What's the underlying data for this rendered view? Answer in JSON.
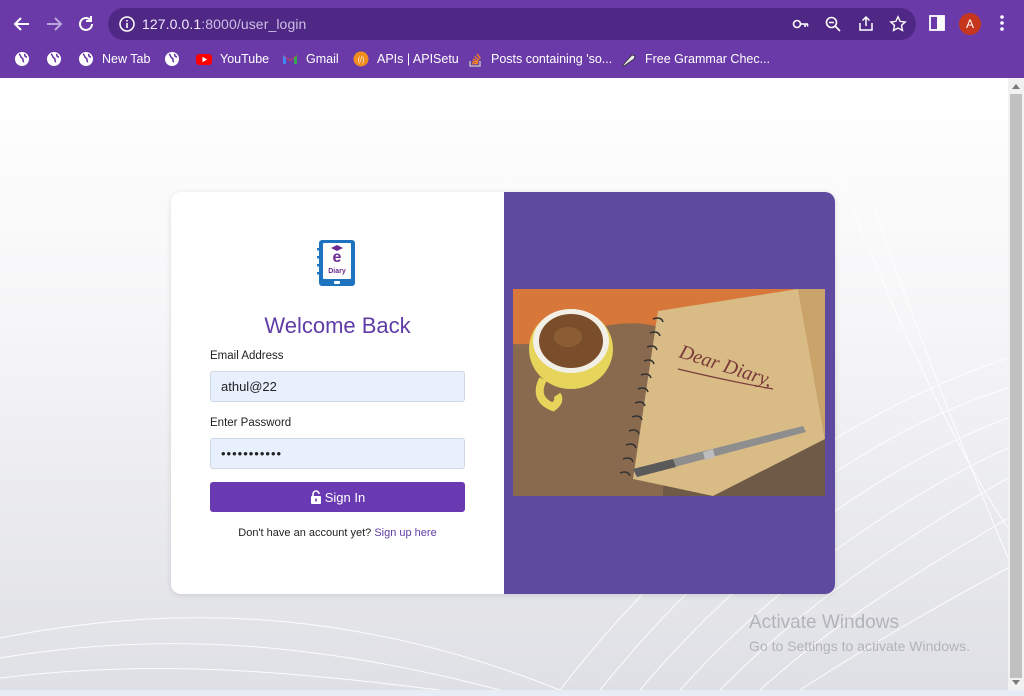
{
  "browser": {
    "url_host": "127.0.0.1",
    "url_path": ":8000/user_login",
    "avatar_letter": "A",
    "bookmarks": [
      {
        "label": "",
        "icon": "globe-icon"
      },
      {
        "label": "",
        "icon": "globe-icon"
      },
      {
        "label": "New Tab",
        "icon": "globe-icon"
      },
      {
        "label": "",
        "icon": "globe-icon"
      },
      {
        "label": "YouTube",
        "icon": "youtube-icon"
      },
      {
        "label": "Gmail",
        "icon": "gmail-icon"
      },
      {
        "label": "APIs | APISetu",
        "icon": "apisetu-icon"
      },
      {
        "label": "Posts containing 'so...",
        "icon": "stackoverflow-icon"
      },
      {
        "label": "Free Grammar Chec...",
        "icon": "quill-icon"
      }
    ]
  },
  "login": {
    "logo_text": "Diary",
    "title": "Welcome Back",
    "email_label": "Email Address",
    "email_value": "athul@22",
    "password_label": "Enter Password",
    "password_value": "•••••••••••",
    "signin_label": "Sign In",
    "signup_prompt": "Don't have an account yet?",
    "signup_link": "Sign up here"
  },
  "image": {
    "caption_text": "Dear Diary,"
  },
  "watermark": {
    "line1": "Activate Windows",
    "line2": "Go to Settings to activate Windows."
  },
  "colors": {
    "chrome": "#6a3aa8",
    "accent": "#6a3ab2",
    "panel": "#5e4a9e"
  }
}
